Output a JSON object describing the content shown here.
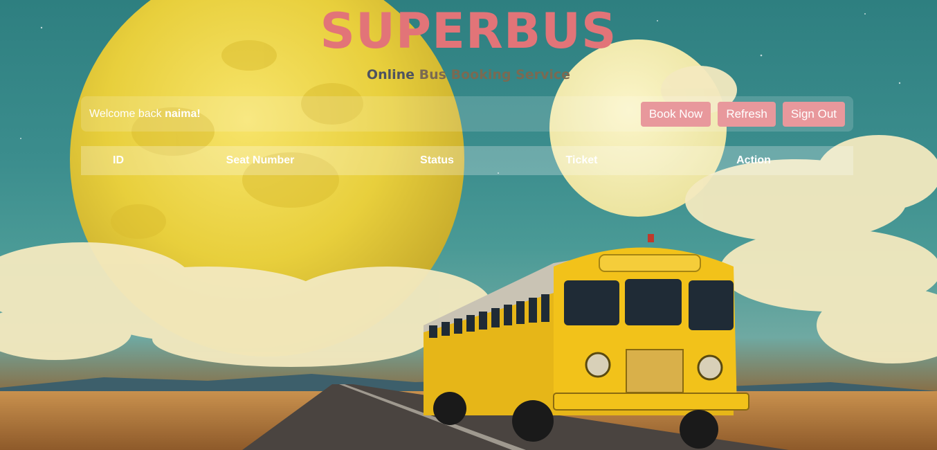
{
  "header": {
    "brand": "SUPERBUS",
    "tagline_prefix": "Online",
    "tagline_suffix": "Bus Booking Service"
  },
  "navbar": {
    "welcome_prefix": "Welcome back",
    "username": "naima!",
    "buttons": [
      "Book Now",
      "Refresh",
      "Sign Out"
    ]
  },
  "table": {
    "headers": [
      "ID",
      "Seat Number",
      "Status",
      "Ticket",
      "Action"
    ]
  },
  "colors": {
    "brand": "#e27478",
    "button": "#e8989c",
    "sky": "#2e7f80",
    "bus": "#f2c21a"
  }
}
